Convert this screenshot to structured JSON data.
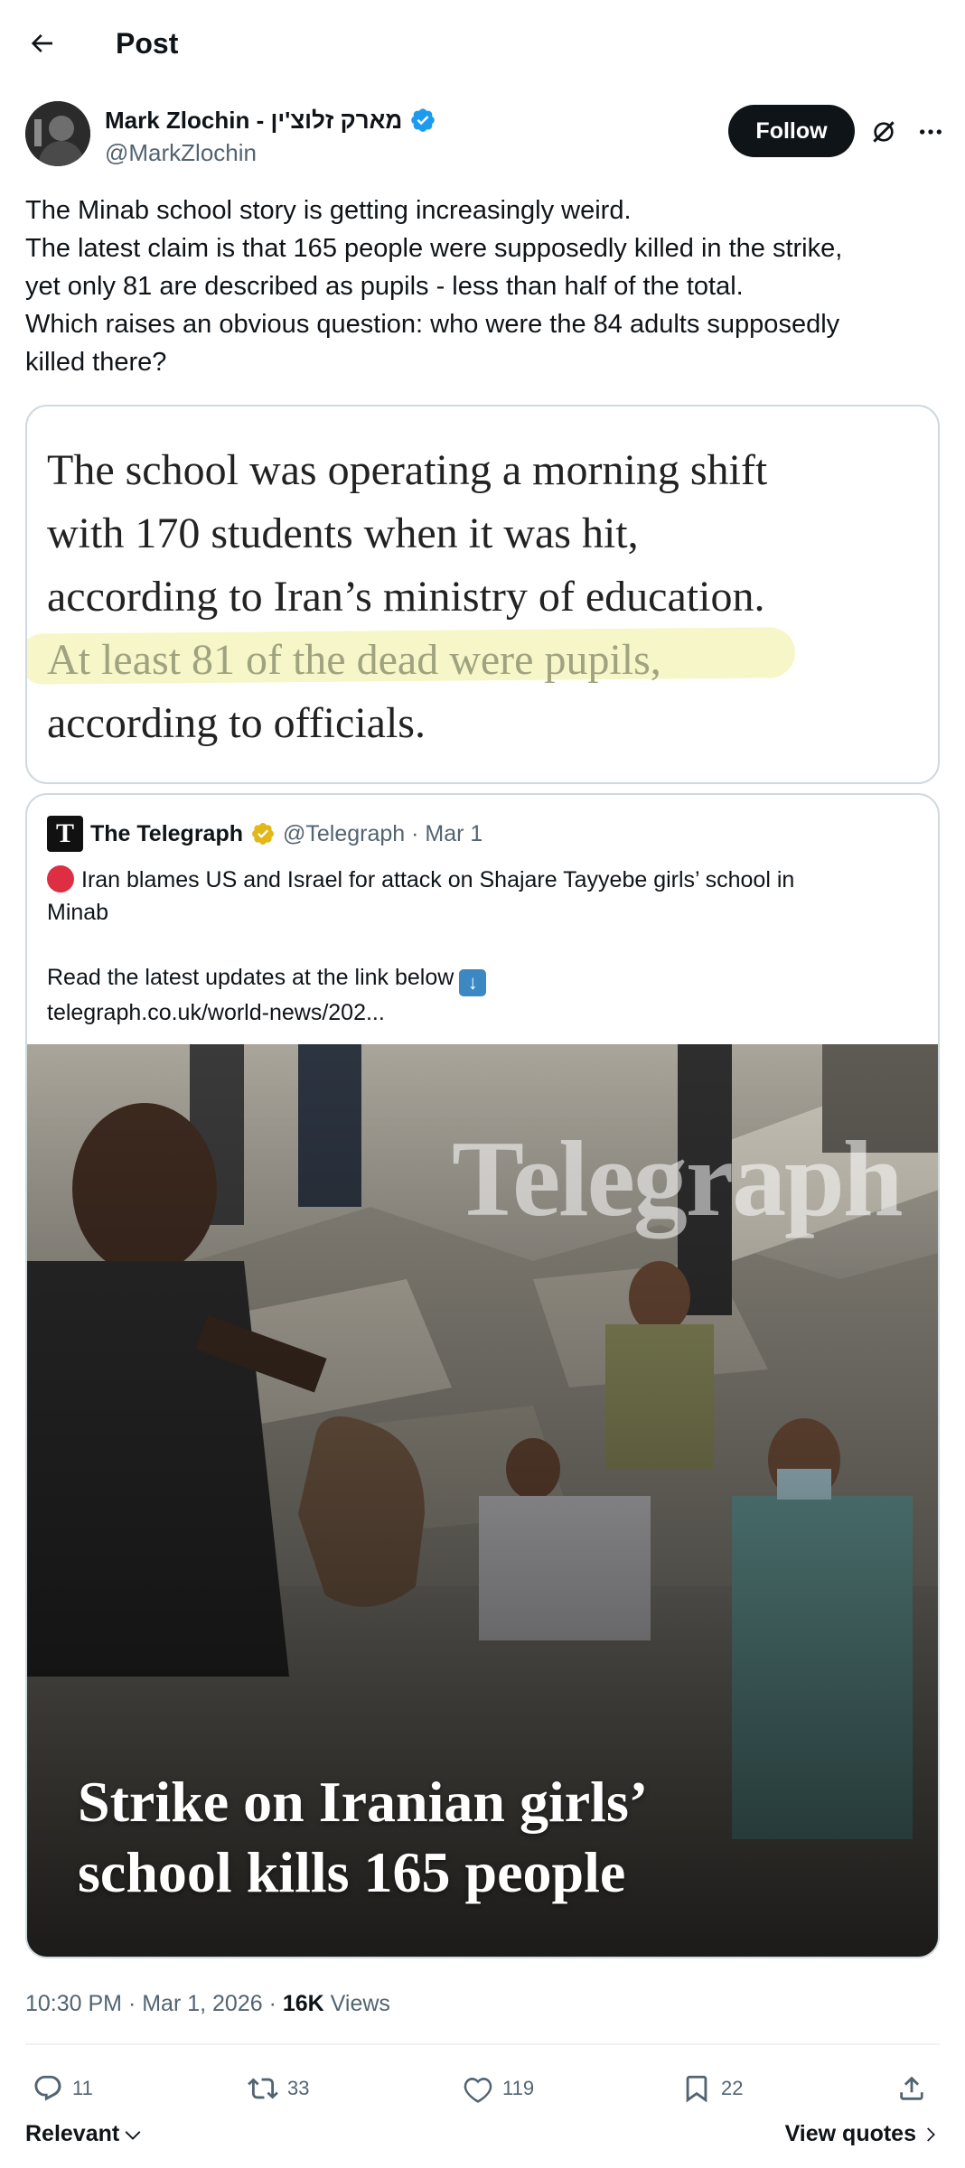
{
  "header": {
    "title": "Post"
  },
  "author": {
    "name": "Mark Zlochin - מארק זלוצ'ין",
    "handle": "@MarkZlochin",
    "follow_label": "Follow",
    "verified_color": "#1d9bf0"
  },
  "post": {
    "lines": [
      "The Minab school story is getting increasingly weird.",
      "The latest claim is that 165 people were supposedly killed in the strike,",
      "yet only 81 are described as pupils - less than half of the total.",
      "Which raises an obvious question: who were the 84 adults supposedly",
      "killed there?"
    ]
  },
  "quote_image": {
    "lines": [
      "The school was operating a morning shift",
      "with 170 students when it was hit,",
      "according to Iran’s ministry of education.",
      "At least 81 of the dead were pupils,",
      "according to officials."
    ],
    "highlight_color": "#f6f6c8"
  },
  "quoted_tweet": {
    "name": "The Telegraph",
    "handle_date": "@Telegraph · Mar 1",
    "logo_glyph": "T",
    "text_line1": "Iran blames US and Israel for attack on Shajare Tayyebe girls’ school in",
    "text_line2": "Minab",
    "text_line3": "Read the latest updates at the link below",
    "link": "telegraph.co.uk/world-news/202...",
    "photo_watermark": "Telegraph",
    "photo_headline_1": "Strike on Iranian girls’",
    "photo_headline_2": "school kills 165 people",
    "gold_badge_color": "#e2b719"
  },
  "meta": {
    "time_date": "10:30 PM · Mar 1, 2026 · ",
    "views_count": "16K",
    "views_label": " Views"
  },
  "actions": {
    "replies": "11",
    "reposts": "33",
    "likes": "119",
    "bookmarks": "22"
  },
  "footer": {
    "sort_label": "Relevant",
    "view_quotes_label": "View quotes"
  }
}
